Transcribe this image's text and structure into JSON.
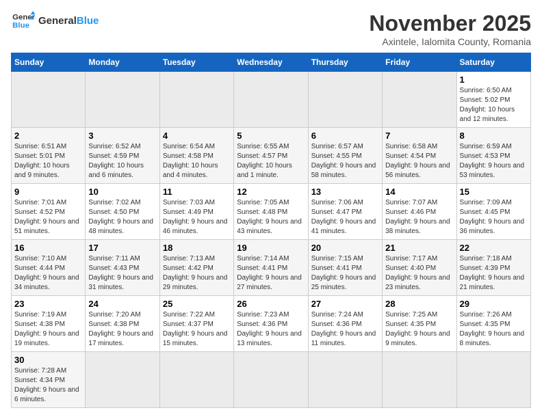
{
  "logo": {
    "text_general": "General",
    "text_blue": "Blue"
  },
  "header": {
    "month_title": "November 2025",
    "subtitle": "Axintele, Ialomita County, Romania"
  },
  "days_of_week": [
    "Sunday",
    "Monday",
    "Tuesday",
    "Wednesday",
    "Thursday",
    "Friday",
    "Saturday"
  ],
  "weeks": [
    [
      {
        "day": "",
        "info": ""
      },
      {
        "day": "",
        "info": ""
      },
      {
        "day": "",
        "info": ""
      },
      {
        "day": "",
        "info": ""
      },
      {
        "day": "",
        "info": ""
      },
      {
        "day": "",
        "info": ""
      },
      {
        "day": "1",
        "info": "Sunrise: 6:50 AM\nSunset: 5:02 PM\nDaylight: 10 hours and 12 minutes."
      }
    ],
    [
      {
        "day": "2",
        "info": "Sunrise: 6:51 AM\nSunset: 5:01 PM\nDaylight: 10 hours and 9 minutes."
      },
      {
        "day": "3",
        "info": "Sunrise: 6:52 AM\nSunset: 4:59 PM\nDaylight: 10 hours and 6 minutes."
      },
      {
        "day": "4",
        "info": "Sunrise: 6:54 AM\nSunset: 4:58 PM\nDaylight: 10 hours and 4 minutes."
      },
      {
        "day": "5",
        "info": "Sunrise: 6:55 AM\nSunset: 4:57 PM\nDaylight: 10 hours and 1 minute."
      },
      {
        "day": "6",
        "info": "Sunrise: 6:57 AM\nSunset: 4:55 PM\nDaylight: 9 hours and 58 minutes."
      },
      {
        "day": "7",
        "info": "Sunrise: 6:58 AM\nSunset: 4:54 PM\nDaylight: 9 hours and 56 minutes."
      },
      {
        "day": "8",
        "info": "Sunrise: 6:59 AM\nSunset: 4:53 PM\nDaylight: 9 hours and 53 minutes."
      }
    ],
    [
      {
        "day": "9",
        "info": "Sunrise: 7:01 AM\nSunset: 4:52 PM\nDaylight: 9 hours and 51 minutes."
      },
      {
        "day": "10",
        "info": "Sunrise: 7:02 AM\nSunset: 4:50 PM\nDaylight: 9 hours and 48 minutes."
      },
      {
        "day": "11",
        "info": "Sunrise: 7:03 AM\nSunset: 4:49 PM\nDaylight: 9 hours and 46 minutes."
      },
      {
        "day": "12",
        "info": "Sunrise: 7:05 AM\nSunset: 4:48 PM\nDaylight: 9 hours and 43 minutes."
      },
      {
        "day": "13",
        "info": "Sunrise: 7:06 AM\nSunset: 4:47 PM\nDaylight: 9 hours and 41 minutes."
      },
      {
        "day": "14",
        "info": "Sunrise: 7:07 AM\nSunset: 4:46 PM\nDaylight: 9 hours and 38 minutes."
      },
      {
        "day": "15",
        "info": "Sunrise: 7:09 AM\nSunset: 4:45 PM\nDaylight: 9 hours and 36 minutes."
      }
    ],
    [
      {
        "day": "16",
        "info": "Sunrise: 7:10 AM\nSunset: 4:44 PM\nDaylight: 9 hours and 34 minutes."
      },
      {
        "day": "17",
        "info": "Sunrise: 7:11 AM\nSunset: 4:43 PM\nDaylight: 9 hours and 31 minutes."
      },
      {
        "day": "18",
        "info": "Sunrise: 7:13 AM\nSunset: 4:42 PM\nDaylight: 9 hours and 29 minutes."
      },
      {
        "day": "19",
        "info": "Sunrise: 7:14 AM\nSunset: 4:41 PM\nDaylight: 9 hours and 27 minutes."
      },
      {
        "day": "20",
        "info": "Sunrise: 7:15 AM\nSunset: 4:41 PM\nDaylight: 9 hours and 25 minutes."
      },
      {
        "day": "21",
        "info": "Sunrise: 7:17 AM\nSunset: 4:40 PM\nDaylight: 9 hours and 23 minutes."
      },
      {
        "day": "22",
        "info": "Sunrise: 7:18 AM\nSunset: 4:39 PM\nDaylight: 9 hours and 21 minutes."
      }
    ],
    [
      {
        "day": "23",
        "info": "Sunrise: 7:19 AM\nSunset: 4:38 PM\nDaylight: 9 hours and 19 minutes."
      },
      {
        "day": "24",
        "info": "Sunrise: 7:20 AM\nSunset: 4:38 PM\nDaylight: 9 hours and 17 minutes."
      },
      {
        "day": "25",
        "info": "Sunrise: 7:22 AM\nSunset: 4:37 PM\nDaylight: 9 hours and 15 minutes."
      },
      {
        "day": "26",
        "info": "Sunrise: 7:23 AM\nSunset: 4:36 PM\nDaylight: 9 hours and 13 minutes."
      },
      {
        "day": "27",
        "info": "Sunrise: 7:24 AM\nSunset: 4:36 PM\nDaylight: 9 hours and 11 minutes."
      },
      {
        "day": "28",
        "info": "Sunrise: 7:25 AM\nSunset: 4:35 PM\nDaylight: 9 hours and 9 minutes."
      },
      {
        "day": "29",
        "info": "Sunrise: 7:26 AM\nSunset: 4:35 PM\nDaylight: 9 hours and 8 minutes."
      }
    ],
    [
      {
        "day": "30",
        "info": "Sunrise: 7:28 AM\nSunset: 4:34 PM\nDaylight: 9 hours and 6 minutes."
      },
      {
        "day": "",
        "info": ""
      },
      {
        "day": "",
        "info": ""
      },
      {
        "day": "",
        "info": ""
      },
      {
        "day": "",
        "info": ""
      },
      {
        "day": "",
        "info": ""
      },
      {
        "day": "",
        "info": ""
      }
    ]
  ]
}
